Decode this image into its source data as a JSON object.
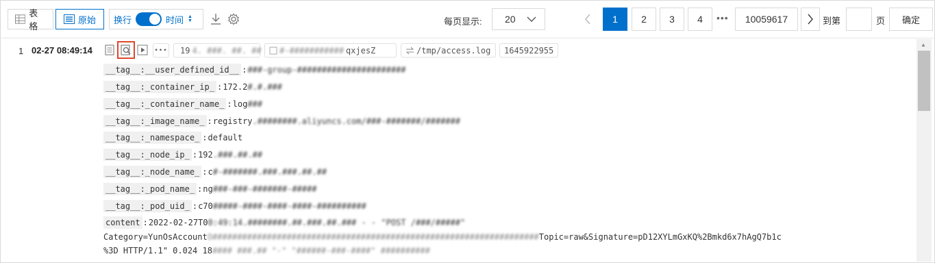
{
  "toolbar": {
    "table_view_label": "表格",
    "raw_view_label": "原始",
    "wrap_label": "换行",
    "time_label": "时间"
  },
  "pagination": {
    "per_page_label": "每页显示:",
    "per_page_value": "20",
    "pages": [
      "1",
      "2",
      "3",
      "4"
    ],
    "active_page": "1",
    "ellipsis": "•••",
    "last_page": "10059617",
    "goto_label": "到第",
    "goto_unit": "页",
    "confirm_label": "确定"
  },
  "log": {
    "index": "1",
    "time": "02-27 08:49:14",
    "more": "•••",
    "ip_chip_visible": "19",
    "ip_chip_blurred": "4. ###. ##. ##",
    "host_chip_blurred": "#-###########",
    "host_chip_visible": "qxjesZ",
    "path_chip": "/tmp/access.log",
    "ts_chip": "1645922955",
    "fields": [
      {
        "key": "__tag__:__user_defined_id__",
        "visible": "",
        "blurred": "###-group-######################"
      },
      {
        "key": "__tag__:_container_ip_",
        "visible": "172.2",
        "blurred": "#.#.###"
      },
      {
        "key": "__tag__:_container_name_",
        "visible": "log",
        "blurred": "###"
      },
      {
        "key": "__tag__:_image_name_",
        "visible": "registry",
        "blurred": ".########.aliyuncs.com/###-#######/#######"
      },
      {
        "key": "__tag__:_namespace_",
        "visible": "default",
        "blurred": ""
      },
      {
        "key": "__tag__:_node_ip_",
        "visible": "192",
        "blurred": ".###.##.##"
      },
      {
        "key": "__tag__:_node_name_",
        "visible": "c",
        "blurred": "#-#######.###.###.##.##"
      },
      {
        "key": "__tag__:_pod_name_",
        "visible": "ng",
        "blurred": "###-###-#######-#####"
      },
      {
        "key": "__tag__:_pod_uid_",
        "visible": "c70",
        "blurred": "#####-####-####-####-##########"
      },
      {
        "key": "content",
        "visible": "2022-02-27T0",
        "blurred": "0:49:14.########.##.###.##.### - - \"POST /###/#####\""
      }
    ],
    "line2_start": "Category=YunOsAccount",
    "line2_blurred": "O##################################################################",
    "line2_end": "Topic=raw&Signature=pD12XYLmGxKQ%2Bmkd6x7hAgQ7b1c",
    "line3_start": "%3D HTTP/1.1\" 0.024 18",
    "line3_blurred": "#### ###.## \"-\" \"######-###-####\" ##########"
  },
  "icons": {
    "table": "table-grid-icon",
    "raw": "list-icon",
    "download": "download-icon",
    "settings": "gear-icon",
    "prev": "chevron-left-icon",
    "next": "chevron-right-icon",
    "dropdown": "chevron-down-icon",
    "doc": "document-icon",
    "context": "context-search-icon",
    "play": "play-icon",
    "ip": "ip-icon",
    "host": "host-icon",
    "path": "swap-arrows-icon"
  },
  "colors": {
    "accent": "#0070cc",
    "highlight": "#e0452f"
  }
}
